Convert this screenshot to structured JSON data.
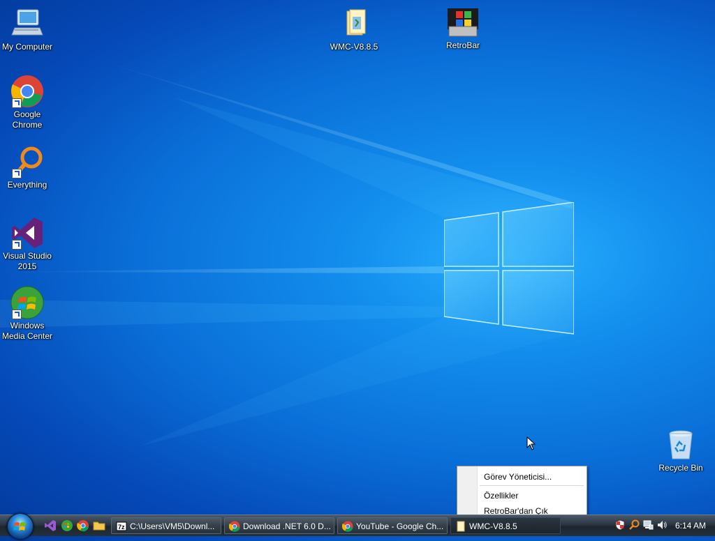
{
  "desktop": {
    "icons": [
      {
        "label": "My Computer",
        "icon": "computer-icon"
      },
      {
        "label": "Google Chrome",
        "icon": "chrome-icon"
      },
      {
        "label": "Everything",
        "icon": "everything-search-icon"
      },
      {
        "label": "Visual Studio 2015",
        "icon": "visual-studio-icon"
      },
      {
        "label": "Windows Media Center",
        "icon": "windows-media-center-icon"
      },
      {
        "label": "WMC-V8.8.5",
        "icon": "folder-icon"
      },
      {
        "label": "RetroBar",
        "icon": "retrobar-app-icon"
      },
      {
        "label": "Recycle Bin",
        "icon": "recycle-bin-icon"
      }
    ]
  },
  "context_menu": {
    "items": [
      {
        "label": "Görev Yöneticisi..."
      },
      {
        "label": "Özellikler"
      },
      {
        "label": "RetroBar'dan Çık"
      }
    ]
  },
  "taskbar": {
    "quick_launch": [
      "visual-studio-icon",
      "windows-media-center-icon",
      "chrome-icon",
      "folder-icon"
    ],
    "tasks": [
      {
        "label": "C:\\Users\\VM5\\Downl...",
        "icon": "7zip-icon"
      },
      {
        "label": "Download .NET 6.0 D...",
        "icon": "chrome-icon"
      },
      {
        "label": "YouTube - Google Ch...",
        "icon": "chrome-icon"
      },
      {
        "label": "WMC-V8.8.5",
        "icon": "folder-icon"
      }
    ],
    "tray_icons": [
      "security-shield-icon",
      "everything-search-icon",
      "network-icon",
      "volume-icon"
    ],
    "clock": "6:14 AM"
  },
  "colors": {
    "desktop_bg": "#0a6fd8",
    "taskbar_bg": "#2a3542",
    "menu_bg": "#ffffff"
  }
}
